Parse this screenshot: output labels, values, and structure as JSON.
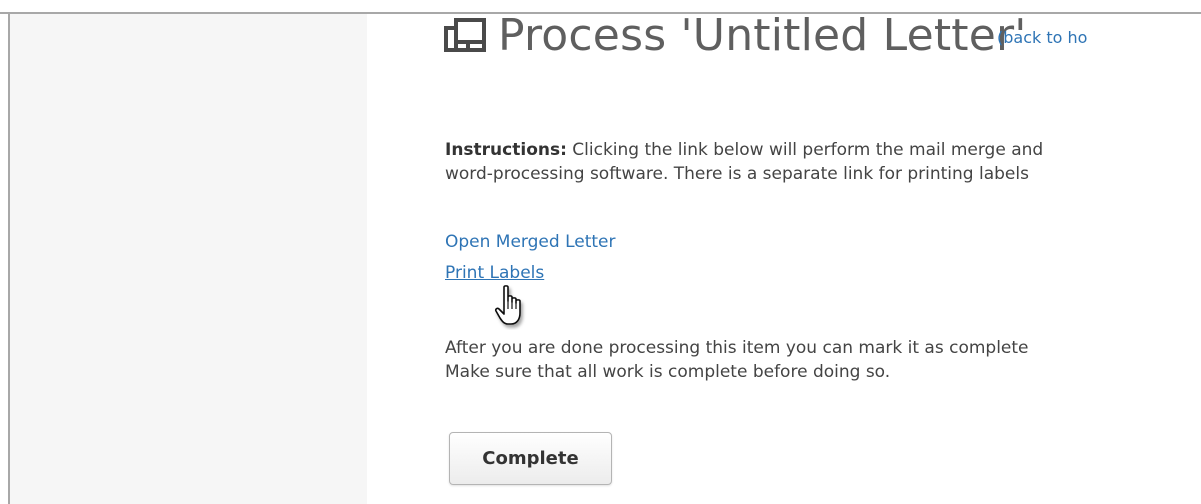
{
  "page": {
    "title": "Process 'Untitled Letter'",
    "back_link": "(back to ho"
  },
  "instructions": {
    "label": "Instructions:",
    "line1": " Clicking the link below will perform the mail merge and",
    "line2": "word-processing software. There is a separate link for printing labels"
  },
  "links": {
    "open_merged_letter": "Open Merged Letter",
    "print_labels": "Print Labels"
  },
  "after": {
    "line1": "After you are done processing this item you can mark it as complete",
    "line2": "Make sure that all work is complete before doing so."
  },
  "actions": {
    "complete_label": "Complete"
  },
  "icons": {
    "title_icon": "windows-icon",
    "cursor": "hand-pointer-cursor"
  },
  "colors": {
    "link": "#2e74b5",
    "title": "#5f5f5f",
    "sidebar_bg": "#f6f6f6"
  }
}
